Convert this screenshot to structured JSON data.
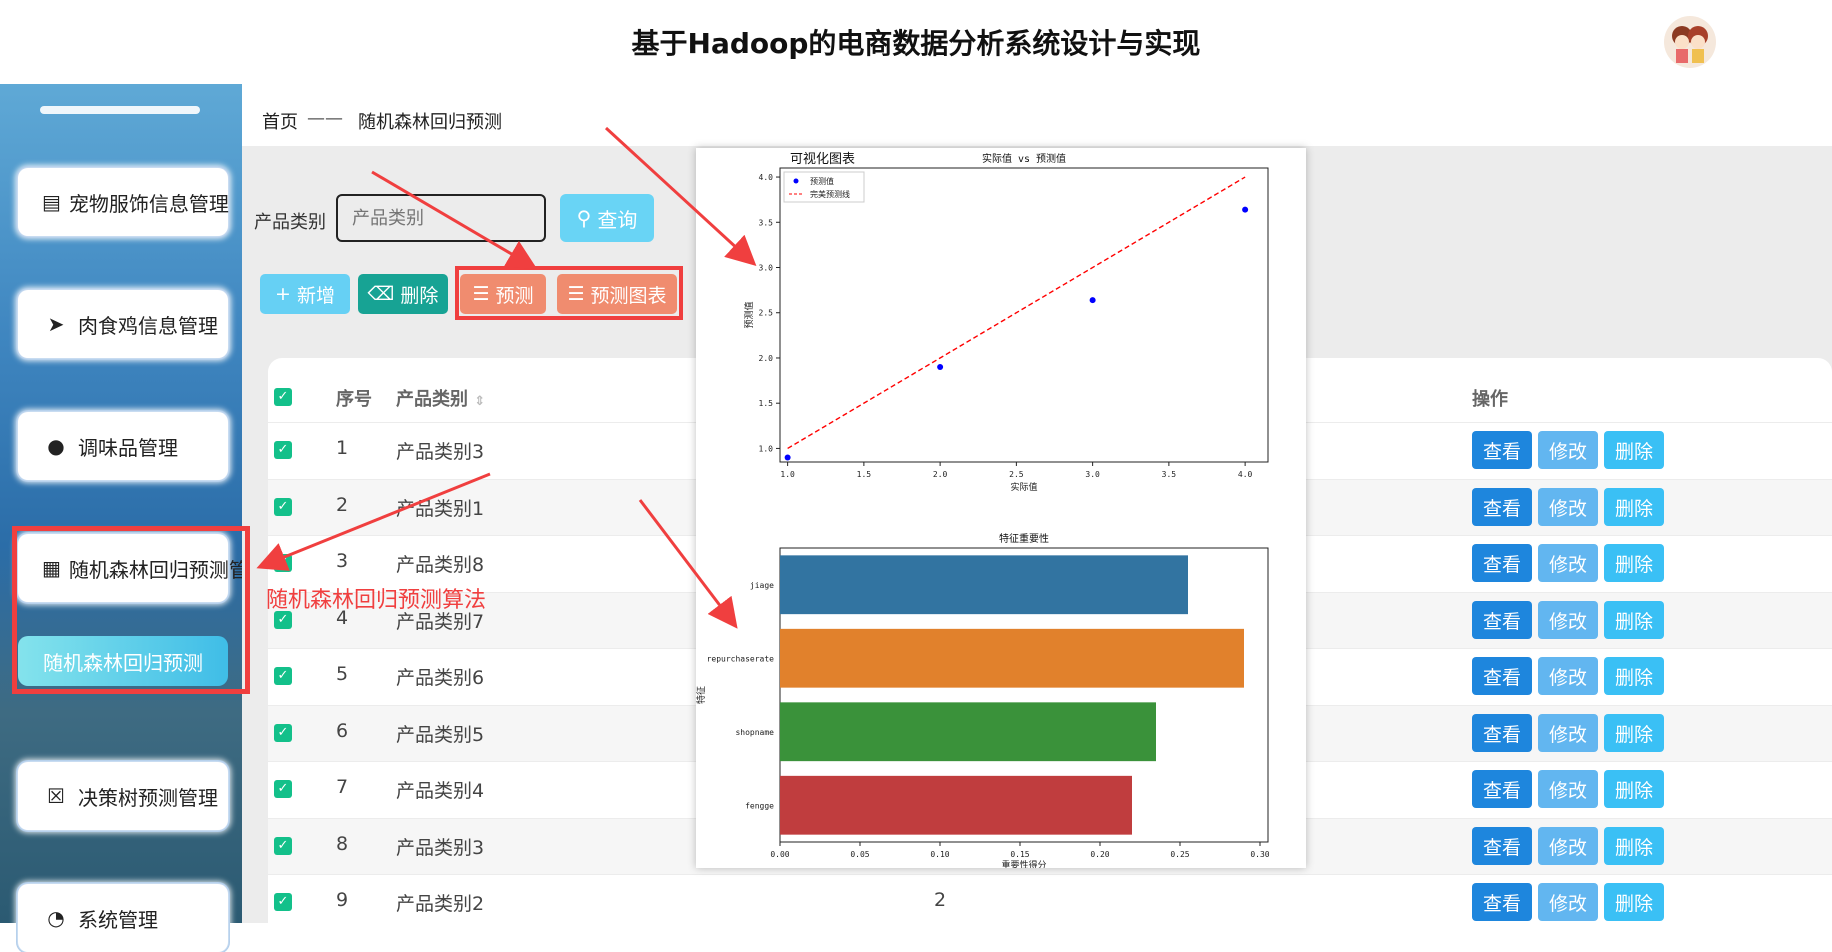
{
  "header": {
    "title": "基于Hadoop的电商数据分析系统设计与实现",
    "avatar_icon": "avatar-icon"
  },
  "sidebar": {
    "items": [
      {
        "label": "宠物服饰信息管理",
        "icon": "clipboard-check-icon"
      },
      {
        "label": "肉食鸡信息管理",
        "icon": "paper-plane-icon"
      },
      {
        "label": "调味品管理",
        "icon": "user-icon"
      },
      {
        "label": "随机森林回归预测管",
        "icon": "grid-icon"
      },
      {
        "label": "决策树预测管理",
        "icon": "clipboard-x-icon"
      },
      {
        "label": "系统管理",
        "icon": "pie-chart-icon"
      }
    ],
    "sub_item": {
      "label": "随机森林回归预测"
    }
  },
  "breadcrumb": {
    "home": "首页",
    "separator": "——",
    "current": "随机森林回归预测"
  },
  "search": {
    "label": "产品类别",
    "placeholder": "产品类别",
    "button": "查询"
  },
  "toolbar": {
    "add": "新增",
    "delete": "删除",
    "predict": "预测",
    "chart": "预测图表"
  },
  "table": {
    "headers": {
      "index": "序号",
      "category": "产品类别",
      "actions": "操作"
    },
    "rows": [
      {
        "index": "1",
        "category": "产品类别3"
      },
      {
        "index": "2",
        "category": "产品类别1"
      },
      {
        "index": "3",
        "category": "产品类别8"
      },
      {
        "index": "4",
        "category": "产品类别7"
      },
      {
        "index": "5",
        "category": "产品类别6"
      },
      {
        "index": "6",
        "category": "产品类别5"
      },
      {
        "index": "7",
        "category": "产品类别4"
      },
      {
        "index": "8",
        "category": "产品类别3"
      },
      {
        "index": "9",
        "category": "产品类别2",
        "extra": "2"
      }
    ],
    "actions": {
      "view": "查看",
      "edit": "修改",
      "remove": "删除"
    }
  },
  "chart_panel": {
    "title": "可视化图表"
  },
  "annotation": {
    "text": "随机森林回归预测算法"
  },
  "colors": {
    "accent": "#1e86dd",
    "highlight_red": "#f03f3f",
    "teal": "#17a394",
    "orange": "#f08c6f"
  },
  "chart_data": [
    {
      "type": "scatter",
      "title": "实际值 vs 预测值",
      "xlabel": "实际值",
      "ylabel": "预测值",
      "xlim": [
        0.95,
        4.15
      ],
      "ylim": [
        0.85,
        4.1
      ],
      "xticks": [
        "1.0",
        "1.5",
        "2.0",
        "2.5",
        "3.0",
        "3.5",
        "4.0"
      ],
      "yticks": [
        "1.0",
        "1.5",
        "2.0",
        "2.5",
        "3.0",
        "3.5",
        "4.0"
      ],
      "series": [
        {
          "name": "预测值",
          "x": [
            1.0,
            2.0,
            3.0,
            4.0
          ],
          "y": [
            0.9,
            1.9,
            2.64,
            3.64
          ],
          "color": "#0000ff"
        },
        {
          "name": "完美预测线",
          "x": [
            1.0,
            4.0
          ],
          "y": [
            1.0,
            4.0
          ],
          "color": "#ff0000",
          "style": "dashed"
        }
      ],
      "legend": "top-left"
    },
    {
      "type": "bar",
      "orientation": "horizontal",
      "title": "特征重要性",
      "xlabel": "重要性得分",
      "ylabel": "特征",
      "xlim": [
        0,
        0.305
      ],
      "xticks": [
        "0.00",
        "0.05",
        "0.10",
        "0.15",
        "0.20",
        "0.25",
        "0.30"
      ],
      "categories": [
        "jiage",
        "repurchaserate",
        "shopname",
        "fengge"
      ],
      "values": [
        0.255,
        0.29,
        0.235,
        0.22
      ],
      "colors": [
        "#3274a1",
        "#e1812c",
        "#3a923a",
        "#c03d3e"
      ]
    }
  ]
}
